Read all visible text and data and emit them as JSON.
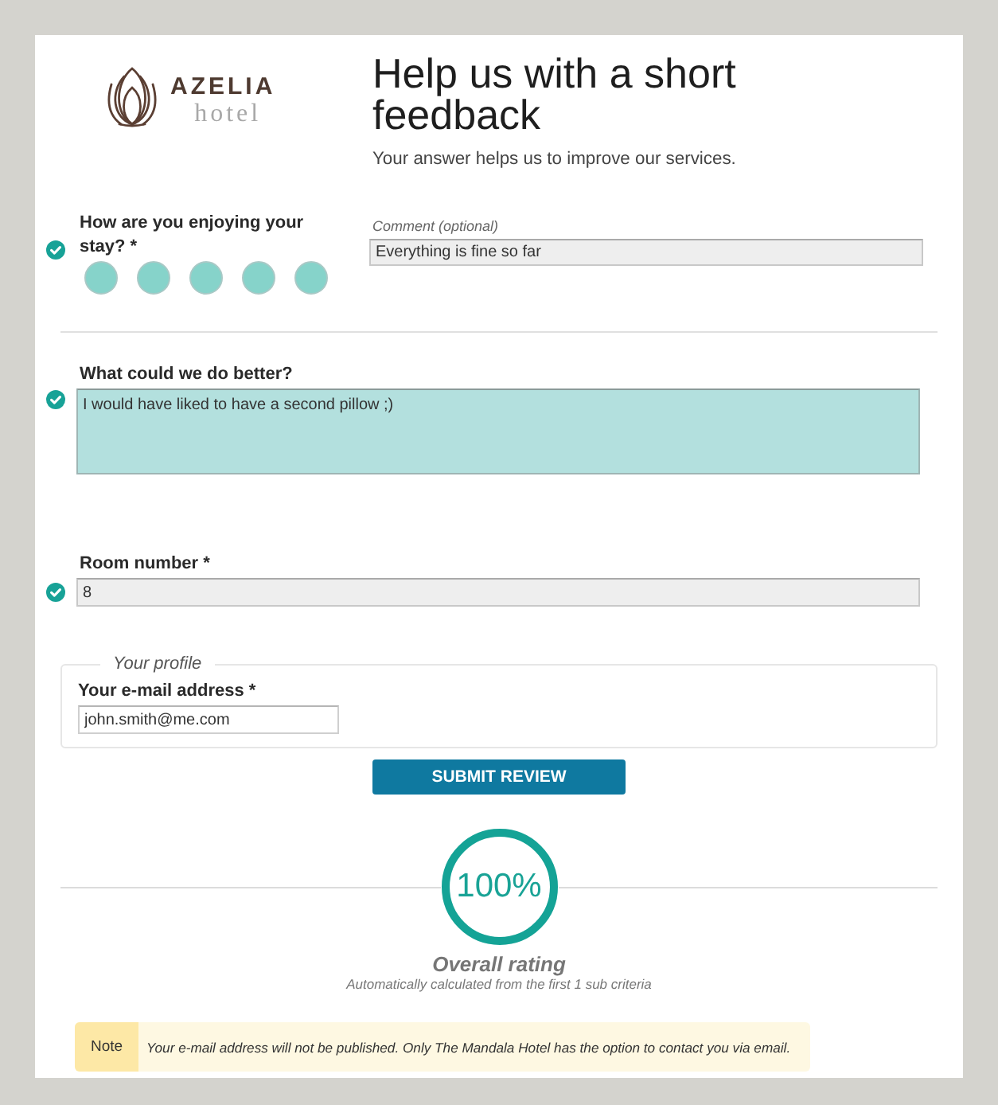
{
  "logo": {
    "name": "AZELIA",
    "tagline": "hotel"
  },
  "header": {
    "title": "Help us with a short feedback",
    "subtitle": "Your answer helps us to improve our services."
  },
  "questions": [
    {
      "kind": "rating",
      "label": "How are you enjoying your stay? *",
      "valid": true,
      "stars": 5,
      "comment": {
        "label": "Comment (optional)",
        "value": "Everything is fine so far"
      }
    },
    {
      "kind": "textarea",
      "label": "What could we do better?",
      "valid": true,
      "active": true,
      "value": "I would have liked to have a second pillow ;)"
    },
    {
      "kind": "text",
      "label": "Room number *",
      "valid": true,
      "active": false,
      "value": "8"
    }
  ],
  "profile": {
    "legend": "Your profile",
    "email_label": "Your e-mail address *",
    "email_value": "john.smith@me.com"
  },
  "submit_button": "SUBMIT REVIEW",
  "overall": {
    "level": 1,
    "reading": "100%",
    "title": "Overall rating",
    "caption": "Automatically calculated from the first 1 sub criteria"
  },
  "note": {
    "tag": "Note",
    "text": "Your e-mail address will not be published. Only The Mandala Hotel has the option to contact you via email."
  }
}
